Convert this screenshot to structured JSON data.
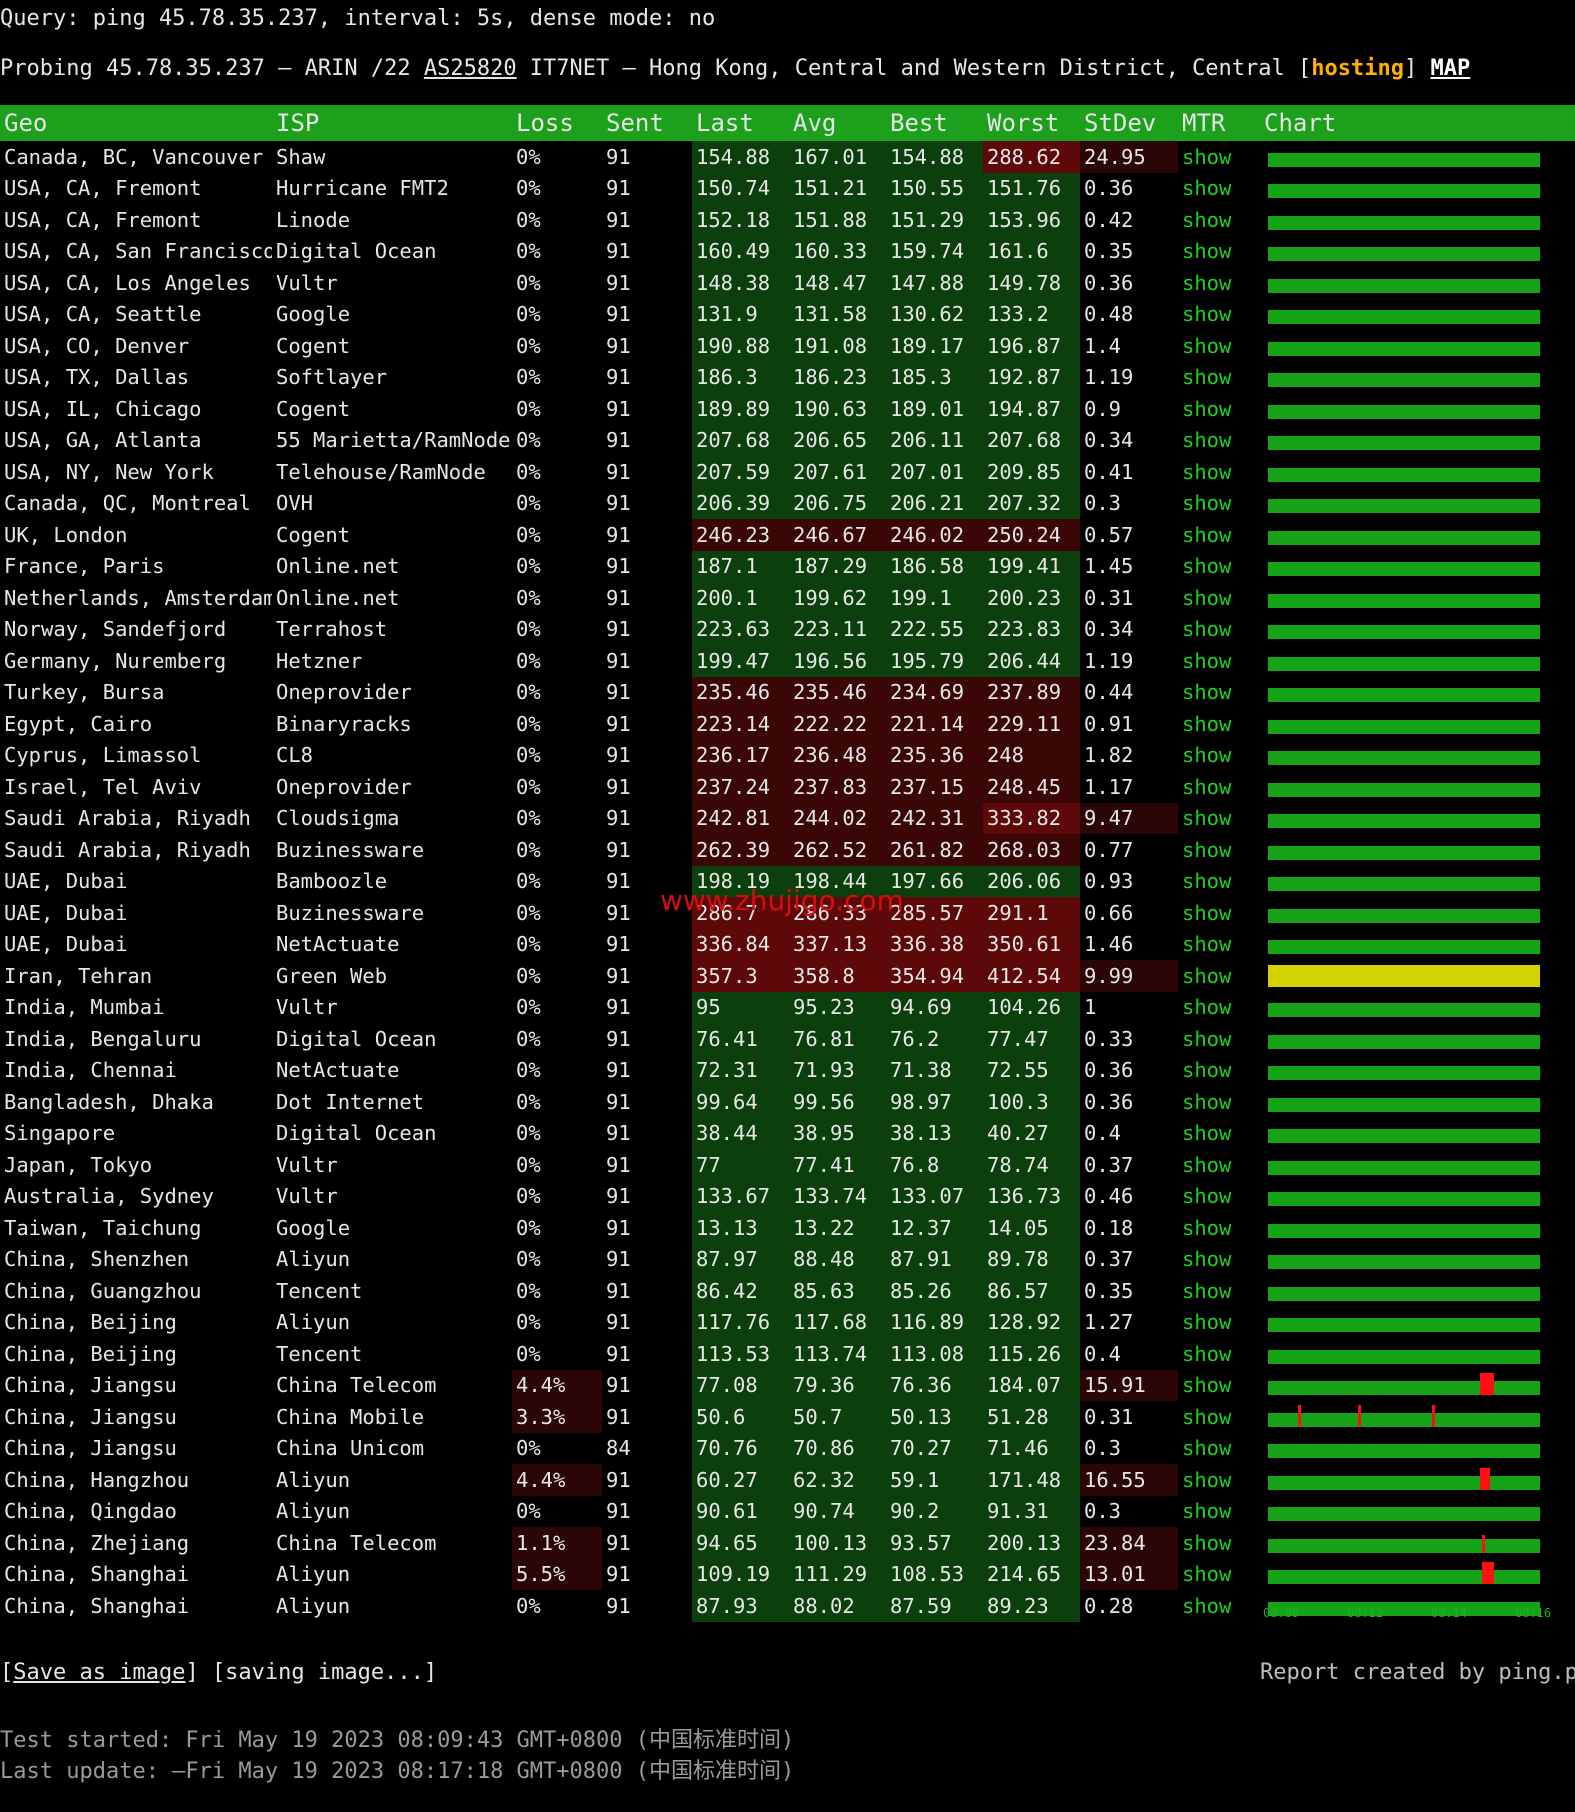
{
  "query": "Query: ping 45.78.35.237, interval: 5s, dense mode: no",
  "probe": {
    "prefix": "Probing 45.78.35.237 – ARIN /22 ",
    "asn": "AS25820",
    "middle": " IT7NET – Hong Kong, Central and Western District, Central [",
    "tag": "hosting",
    "suffix": "] ",
    "map": "MAP"
  },
  "headers": [
    "Geo",
    "ISP",
    "Loss",
    "Sent",
    "Last",
    "Avg",
    "Best",
    "Worst",
    "StDev",
    "MTR",
    "Chart"
  ],
  "rows": [
    [
      "Canada, BC, Vancouver",
      "Shaw",
      "0%",
      "91",
      "154.88",
      "167.01",
      "154.88",
      "288.62",
      "24.95",
      "show"
    ],
    [
      "USA, CA, Fremont",
      "Hurricane FMT2",
      "0%",
      "91",
      "150.74",
      "151.21",
      "150.55",
      "151.76",
      "0.36",
      "show"
    ],
    [
      "USA, CA, Fremont",
      "Linode",
      "0%",
      "91",
      "152.18",
      "151.88",
      "151.29",
      "153.96",
      "0.42",
      "show"
    ],
    [
      "USA, CA, San Francisco",
      "Digital Ocean",
      "0%",
      "91",
      "160.49",
      "160.33",
      "159.74",
      "161.6",
      "0.35",
      "show"
    ],
    [
      "USA, CA, Los Angeles",
      "Vultr",
      "0%",
      "91",
      "148.38",
      "148.47",
      "147.88",
      "149.78",
      "0.36",
      "show"
    ],
    [
      "USA, CA, Seattle",
      "Google",
      "0%",
      "91",
      "131.9",
      "131.58",
      "130.62",
      "133.2",
      "0.48",
      "show"
    ],
    [
      "USA, CO, Denver",
      "Cogent",
      "0%",
      "91",
      "190.88",
      "191.08",
      "189.17",
      "196.87",
      "1.4",
      "show"
    ],
    [
      "USA, TX, Dallas",
      "Softlayer",
      "0%",
      "91",
      "186.3",
      "186.23",
      "185.3",
      "192.87",
      "1.19",
      "show"
    ],
    [
      "USA, IL, Chicago",
      "Cogent",
      "0%",
      "91",
      "189.89",
      "190.63",
      "189.01",
      "194.87",
      "0.9",
      "show"
    ],
    [
      "USA, GA, Atlanta",
      "55 Marietta/RamNode",
      "0%",
      "91",
      "207.68",
      "206.65",
      "206.11",
      "207.68",
      "0.34",
      "show"
    ],
    [
      "USA, NY, New York",
      "Telehouse/RamNode",
      "0%",
      "91",
      "207.59",
      "207.61",
      "207.01",
      "209.85",
      "0.41",
      "show"
    ],
    [
      "Canada, QC, Montreal",
      "OVH",
      "0%",
      "91",
      "206.39",
      "206.75",
      "206.21",
      "207.32",
      "0.3",
      "show"
    ],
    [
      "UK, London",
      "Cogent",
      "0%",
      "91",
      "246.23",
      "246.67",
      "246.02",
      "250.24",
      "0.57",
      "show"
    ],
    [
      "France, Paris",
      "Online.net",
      "0%",
      "91",
      "187.1",
      "187.29",
      "186.58",
      "199.41",
      "1.45",
      "show"
    ],
    [
      "Netherlands, Amsterdam",
      "Online.net",
      "0%",
      "91",
      "200.1",
      "199.62",
      "199.1",
      "200.23",
      "0.31",
      "show"
    ],
    [
      "Norway, Sandefjord",
      "Terrahost",
      "0%",
      "91",
      "223.63",
      "223.11",
      "222.55",
      "223.83",
      "0.34",
      "show"
    ],
    [
      "Germany, Nuremberg",
      "Hetzner",
      "0%",
      "91",
      "199.47",
      "196.56",
      "195.79",
      "206.44",
      "1.19",
      "show"
    ],
    [
      "Turkey, Bursa",
      "Oneprovider",
      "0%",
      "91",
      "235.46",
      "235.46",
      "234.69",
      "237.89",
      "0.44",
      "show"
    ],
    [
      "Egypt, Cairo",
      "Binaryracks",
      "0%",
      "91",
      "223.14",
      "222.22",
      "221.14",
      "229.11",
      "0.91",
      "show"
    ],
    [
      "Cyprus, Limassol",
      "CL8",
      "0%",
      "91",
      "236.17",
      "236.48",
      "235.36",
      "248",
      "1.82",
      "show"
    ],
    [
      "Israel, Tel Aviv",
      "Oneprovider",
      "0%",
      "91",
      "237.24",
      "237.83",
      "237.15",
      "248.45",
      "1.17",
      "show"
    ],
    [
      "Saudi Arabia, Riyadh",
      "Cloudsigma",
      "0%",
      "91",
      "242.81",
      "244.02",
      "242.31",
      "333.82",
      "9.47",
      "show"
    ],
    [
      "Saudi Arabia, Riyadh",
      "Buzinessware",
      "0%",
      "91",
      "262.39",
      "262.52",
      "261.82",
      "268.03",
      "0.77",
      "show"
    ],
    [
      "UAE, Dubai",
      "Bamboozle",
      "0%",
      "91",
      "198.19",
      "198.44",
      "197.66",
      "206.06",
      "0.93",
      "show"
    ],
    [
      "UAE, Dubai",
      "Buzinessware",
      "0%",
      "91",
      "286.7",
      "286.33",
      "285.57",
      "291.1",
      "0.66",
      "show"
    ],
    [
      "UAE, Dubai",
      "NetActuate",
      "0%",
      "91",
      "336.84",
      "337.13",
      "336.38",
      "350.61",
      "1.46",
      "show"
    ],
    [
      "Iran, Tehran",
      "Green Web",
      "0%",
      "91",
      "357.3",
      "358.8",
      "354.94",
      "412.54",
      "9.99",
      "show"
    ],
    [
      "India, Mumbai",
      "Vultr",
      "0%",
      "91",
      "95",
      "95.23",
      "94.69",
      "104.26",
      "1",
      "show"
    ],
    [
      "India, Bengaluru",
      "Digital Ocean",
      "0%",
      "91",
      "76.41",
      "76.81",
      "76.2",
      "77.47",
      "0.33",
      "show"
    ],
    [
      "India, Chennai",
      "NetActuate",
      "0%",
      "91",
      "72.31",
      "71.93",
      "71.38",
      "72.55",
      "0.36",
      "show"
    ],
    [
      "Bangladesh, Dhaka",
      "Dot Internet",
      "0%",
      "91",
      "99.64",
      "99.56",
      "98.97",
      "100.3",
      "0.36",
      "show"
    ],
    [
      "Singapore",
      "Digital Ocean",
      "0%",
      "91",
      "38.44",
      "38.95",
      "38.13",
      "40.27",
      "0.4",
      "show"
    ],
    [
      "Japan, Tokyo",
      "Vultr",
      "0%",
      "91",
      "77",
      "77.41",
      "76.8",
      "78.74",
      "0.37",
      "show"
    ],
    [
      "Australia, Sydney",
      "Vultr",
      "0%",
      "91",
      "133.67",
      "133.74",
      "133.07",
      "136.73",
      "0.46",
      "show"
    ],
    [
      "Taiwan, Taichung",
      "Google",
      "0%",
      "91",
      "13.13",
      "13.22",
      "12.37",
      "14.05",
      "0.18",
      "show"
    ],
    [
      "China, Shenzhen",
      "Aliyun",
      "0%",
      "91",
      "87.97",
      "88.48",
      "87.91",
      "89.78",
      "0.37",
      "show"
    ],
    [
      "China, Guangzhou",
      "Tencent",
      "0%",
      "91",
      "86.42",
      "85.63",
      "85.26",
      "86.57",
      "0.35",
      "show"
    ],
    [
      "China, Beijing",
      "Aliyun",
      "0%",
      "91",
      "117.76",
      "117.68",
      "116.89",
      "128.92",
      "1.27",
      "show"
    ],
    [
      "China, Beijing",
      "Tencent",
      "0%",
      "91",
      "113.53",
      "113.74",
      "113.08",
      "115.26",
      "0.4",
      "show"
    ],
    [
      "China, Jiangsu",
      "China Telecom",
      "4.4%",
      "91",
      "77.08",
      "79.36",
      "76.36",
      "184.07",
      "15.91",
      "show"
    ],
    [
      "China, Jiangsu",
      "China Mobile",
      "3.3%",
      "91",
      "50.6",
      "50.7",
      "50.13",
      "51.28",
      "0.31",
      "show"
    ],
    [
      "China, Jiangsu",
      "China Unicom",
      "0%",
      "84",
      "70.76",
      "70.86",
      "70.27",
      "71.46",
      "0.3",
      "show"
    ],
    [
      "China, Hangzhou",
      "Aliyun",
      "4.4%",
      "91",
      "60.27",
      "62.32",
      "59.1",
      "171.48",
      "16.55",
      "show"
    ],
    [
      "China, Qingdao",
      "Aliyun",
      "0%",
      "91",
      "90.61",
      "90.74",
      "90.2",
      "91.31",
      "0.3",
      "show"
    ],
    [
      "China, Zhejiang",
      "China Telecom",
      "1.1%",
      "91",
      "94.65",
      "100.13",
      "93.57",
      "200.13",
      "23.84",
      "show"
    ],
    [
      "China, Shanghai",
      "Aliyun",
      "5.5%",
      "91",
      "109.19",
      "111.29",
      "108.53",
      "214.65",
      "13.01",
      "show"
    ],
    [
      "China, Shanghai",
      "Aliyun",
      "0%",
      "91",
      "87.93",
      "88.02",
      "87.59",
      "89.23",
      "0.28",
      "show"
    ]
  ],
  "chart_axis": [
    "08:09",
    "08:12",
    "08:14",
    "08:16"
  ],
  "footer": {
    "save": "Save as image",
    "saving": "[saving image...]",
    "credit": "Report created by ping.pe",
    "started": "Test started: Fri May 19 2023 08:09:43 GMT+0800 (中国标准时间)",
    "updated": "Last update: –Fri May 19 2023 08:17:18 GMT+0800 (中国标准时间)"
  },
  "watermark": "www.zhujigo.com",
  "colors": {
    "header_green": "#1da11d",
    "cell_green": "#0b3f0b",
    "cell_red": "#3a0606",
    "show_link": "#20d020",
    "hosting": "#ffb000",
    "loss_spike": "#ff1010",
    "chart_yellow": "#d3d300"
  }
}
